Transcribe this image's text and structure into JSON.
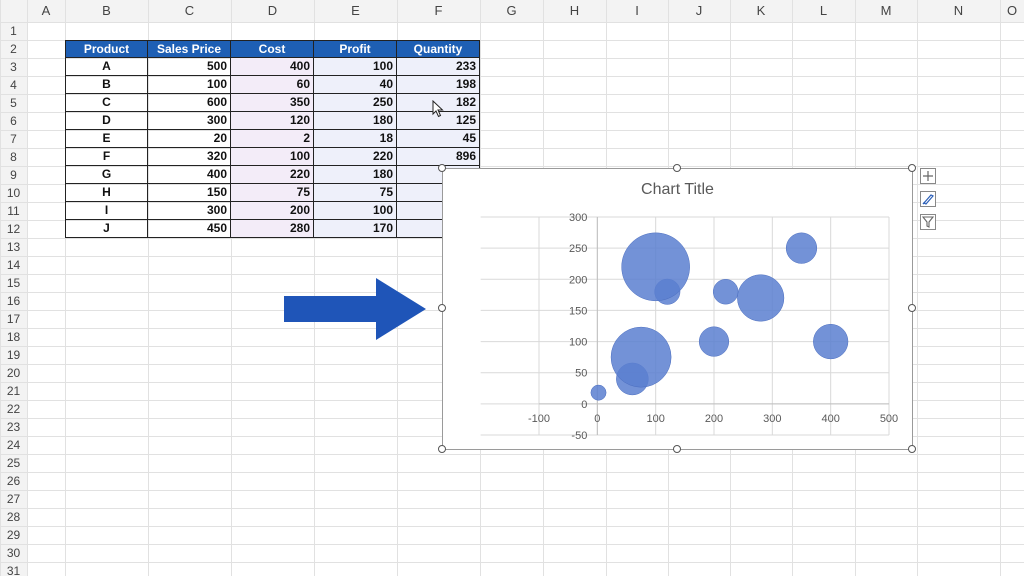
{
  "columns": [
    "A",
    "B",
    "C",
    "D",
    "E",
    "F",
    "G",
    "H",
    "I",
    "J",
    "K",
    "L",
    "M",
    "N",
    "O"
  ],
  "rows": [
    "1",
    "2",
    "3",
    "4",
    "5",
    "6",
    "7",
    "8",
    "9",
    "10",
    "11",
    "12",
    "13",
    "14",
    "15",
    "16",
    "17",
    "18",
    "19",
    "20",
    "21",
    "22",
    "23",
    "24",
    "25",
    "26",
    "27",
    "28",
    "29",
    "30",
    "31"
  ],
  "table": {
    "headers": [
      "Product",
      "Sales Price",
      "Cost",
      "Profit",
      "Quantity"
    ],
    "rows": [
      [
        "A",
        "500",
        "400",
        "100",
        "233"
      ],
      [
        "B",
        "100",
        "60",
        "40",
        "198"
      ],
      [
        "C",
        "600",
        "350",
        "250",
        "182"
      ],
      [
        "D",
        "300",
        "120",
        "180",
        "125"
      ],
      [
        "E",
        "20",
        "2",
        "18",
        "45"
      ],
      [
        "F",
        "320",
        "100",
        "220",
        "896"
      ],
      [
        "G",
        "400",
        "220",
        "180",
        ""
      ],
      [
        "H",
        "150",
        "75",
        "75",
        ""
      ],
      [
        "I",
        "300",
        "200",
        "100",
        ""
      ],
      [
        "J",
        "450",
        "280",
        "170",
        ""
      ]
    ]
  },
  "chart": {
    "title": "Chart Title",
    "tools": [
      "chart-elements-icon",
      "chart-styles-icon",
      "chart-filters-icon"
    ]
  },
  "chart_data": {
    "type": "scatter",
    "subtype": "bubble",
    "title": "Chart Title",
    "xlim": [
      -100,
      500
    ],
    "ylim": [
      -50,
      300
    ],
    "xticks": [
      -100,
      0,
      100,
      200,
      300,
      400,
      500
    ],
    "yticks": [
      -50,
      0,
      50,
      100,
      150,
      200,
      250,
      300
    ],
    "grid": true,
    "color": "#5b7fd0",
    "points": [
      {
        "x": 400,
        "y": 100,
        "size": 233
      },
      {
        "x": 60,
        "y": 40,
        "size": 198
      },
      {
        "x": 350,
        "y": 250,
        "size": 182
      },
      {
        "x": 120,
        "y": 180,
        "size": 125
      },
      {
        "x": 2,
        "y": 18,
        "size": 45
      },
      {
        "x": 100,
        "y": 220,
        "size": 896
      },
      {
        "x": 220,
        "y": 180,
        "size": 120
      },
      {
        "x": 75,
        "y": 75,
        "size": 700
      },
      {
        "x": 200,
        "y": 100,
        "size": 170
      },
      {
        "x": 280,
        "y": 170,
        "size": 420
      }
    ]
  },
  "colors": {
    "header_fill": "#1e5fb4",
    "arrow": "#1f55b8",
    "bubble": "#5b7fd0"
  }
}
